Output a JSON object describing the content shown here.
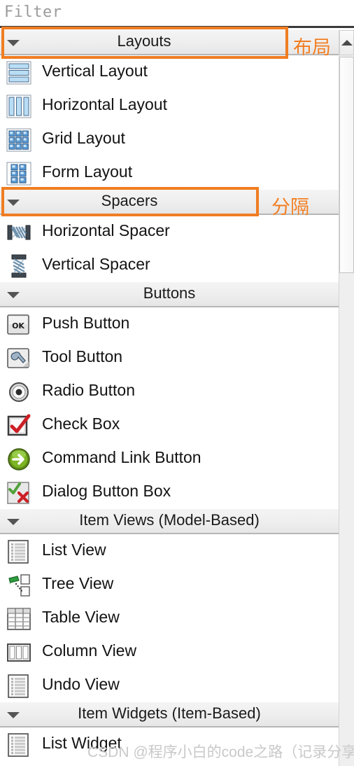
{
  "filter": {
    "placeholder": "Filter",
    "value": ""
  },
  "annotations": {
    "layouts_cn": "布局",
    "spacers_cn": "分隔",
    "accent_color": "#f07d22"
  },
  "watermark": "CSDN @程序小白的code之路（记录分享）",
  "scrollbar": {
    "up_arrow": "scroll-up-arrow"
  },
  "sections": [
    {
      "title": "Layouts",
      "collapse_icon": "chevron-down-icon",
      "items": [
        {
          "label": "Vertical Layout",
          "icon": "vertical-layout-icon"
        },
        {
          "label": "Horizontal Layout",
          "icon": "horizontal-layout-icon"
        },
        {
          "label": "Grid Layout",
          "icon": "grid-layout-icon"
        },
        {
          "label": "Form Layout",
          "icon": "form-layout-icon"
        }
      ]
    },
    {
      "title": "Spacers",
      "collapse_icon": "chevron-down-icon",
      "items": [
        {
          "label": "Horizontal Spacer",
          "icon": "horizontal-spacer-icon"
        },
        {
          "label": "Vertical Spacer",
          "icon": "vertical-spacer-icon"
        }
      ]
    },
    {
      "title": "Buttons",
      "collapse_icon": "chevron-down-icon",
      "items": [
        {
          "label": "Push Button",
          "icon": "push-button-icon"
        },
        {
          "label": "Tool Button",
          "icon": "tool-button-icon"
        },
        {
          "label": "Radio Button",
          "icon": "radio-button-icon"
        },
        {
          "label": "Check Box",
          "icon": "check-box-icon"
        },
        {
          "label": "Command Link Button",
          "icon": "command-link-button-icon"
        },
        {
          "label": "Dialog Button Box",
          "icon": "dialog-button-box-icon"
        }
      ]
    },
    {
      "title": "Item Views (Model-Based)",
      "collapse_icon": "chevron-down-icon",
      "items": [
        {
          "label": "List View",
          "icon": "list-view-icon"
        },
        {
          "label": "Tree View",
          "icon": "tree-view-icon"
        },
        {
          "label": "Table View",
          "icon": "table-view-icon"
        },
        {
          "label": "Column View",
          "icon": "column-view-icon"
        },
        {
          "label": "Undo View",
          "icon": "undo-view-icon"
        }
      ]
    },
    {
      "title": "Item Widgets (Item-Based)",
      "collapse_icon": "chevron-down-icon",
      "items": [
        {
          "label": "List Widget",
          "icon": "list-widget-icon"
        }
      ]
    }
  ]
}
